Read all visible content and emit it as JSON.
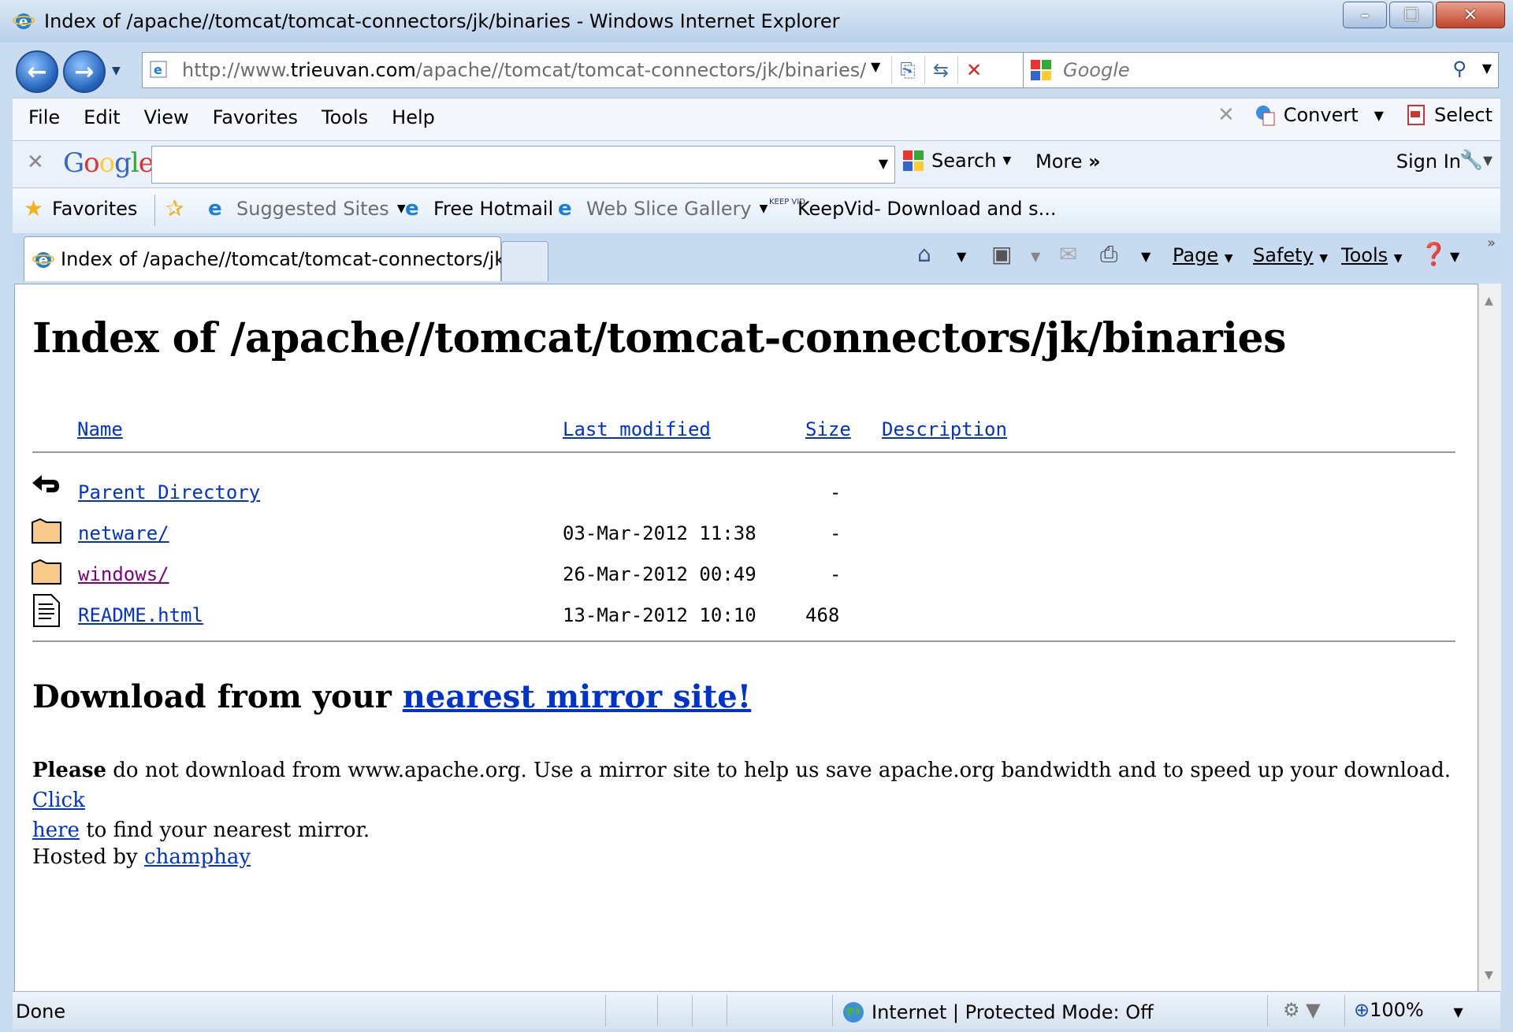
{
  "window": {
    "title": "Index of /apache//tomcat/tomcat-connectors/jk/binaries - Windows Internet Explorer"
  },
  "address": {
    "url_prefix": "http://www.",
    "url_host": "trieuvan.com",
    "url_path": "/apache//tomcat/tomcat-connectors/jk/binaries/",
    "search_placeholder": "Google"
  },
  "menu": {
    "items": [
      "File",
      "Edit",
      "View",
      "Favorites",
      "Tools",
      "Help"
    ],
    "convert_label": "Convert",
    "select_label": "Select"
  },
  "google_toolbar": {
    "logo": "Google",
    "search_label": "Search",
    "more_label": "More",
    "sign_in_label": "Sign In"
  },
  "favorites_bar": {
    "favorites_label": "Favorites",
    "items": [
      "Suggested Sites",
      "Free Hotmail",
      "Web Slice Gallery",
      "KeepVid- Download and s..."
    ]
  },
  "tabs": {
    "active_label": "Index of /apache//tomcat/tomcat-connectors/jk...",
    "commands": [
      "Page",
      "Safety",
      "Tools"
    ]
  },
  "page": {
    "heading": "Index of /apache//tomcat/tomcat-connectors/jk/binaries",
    "columns": [
      "Name",
      "Last modified",
      "Size",
      "Description"
    ],
    "rows": [
      {
        "name": "Parent Directory",
        "modified": "",
        "size": "-",
        "icon": "back-arrow-icon"
      },
      {
        "name": "netware/",
        "modified": "03-Mar-2012 11:38",
        "size": "-",
        "icon": "folder-icon"
      },
      {
        "name": "windows/",
        "modified": "26-Mar-2012 00:49",
        "size": "-",
        "icon": "folder-icon"
      },
      {
        "name": "README.html",
        "modified": "13-Mar-2012 10:10",
        "size": "468",
        "icon": "text-file-icon"
      }
    ],
    "download_heading_prefix": "Download from your ",
    "download_heading_link": "nearest mirror site!",
    "para_bold": "Please",
    "para_text": " do not download from www.apache.org. Use a mirror site to help us save apache.org bandwidth and to speed up your download. ",
    "para_link_1": "Click",
    "para_link_2": "here",
    "para_tail": " to find your nearest mirror.",
    "hosted_prefix": "Hosted by ",
    "hosted_link": "champhay"
  },
  "status": {
    "text": "Done",
    "zone": "Internet | Protected Mode: Off",
    "zoom": "100%"
  },
  "colors": {
    "link": "#0033cc",
    "visited": "#800080",
    "chrome": "#c9dcf0"
  }
}
